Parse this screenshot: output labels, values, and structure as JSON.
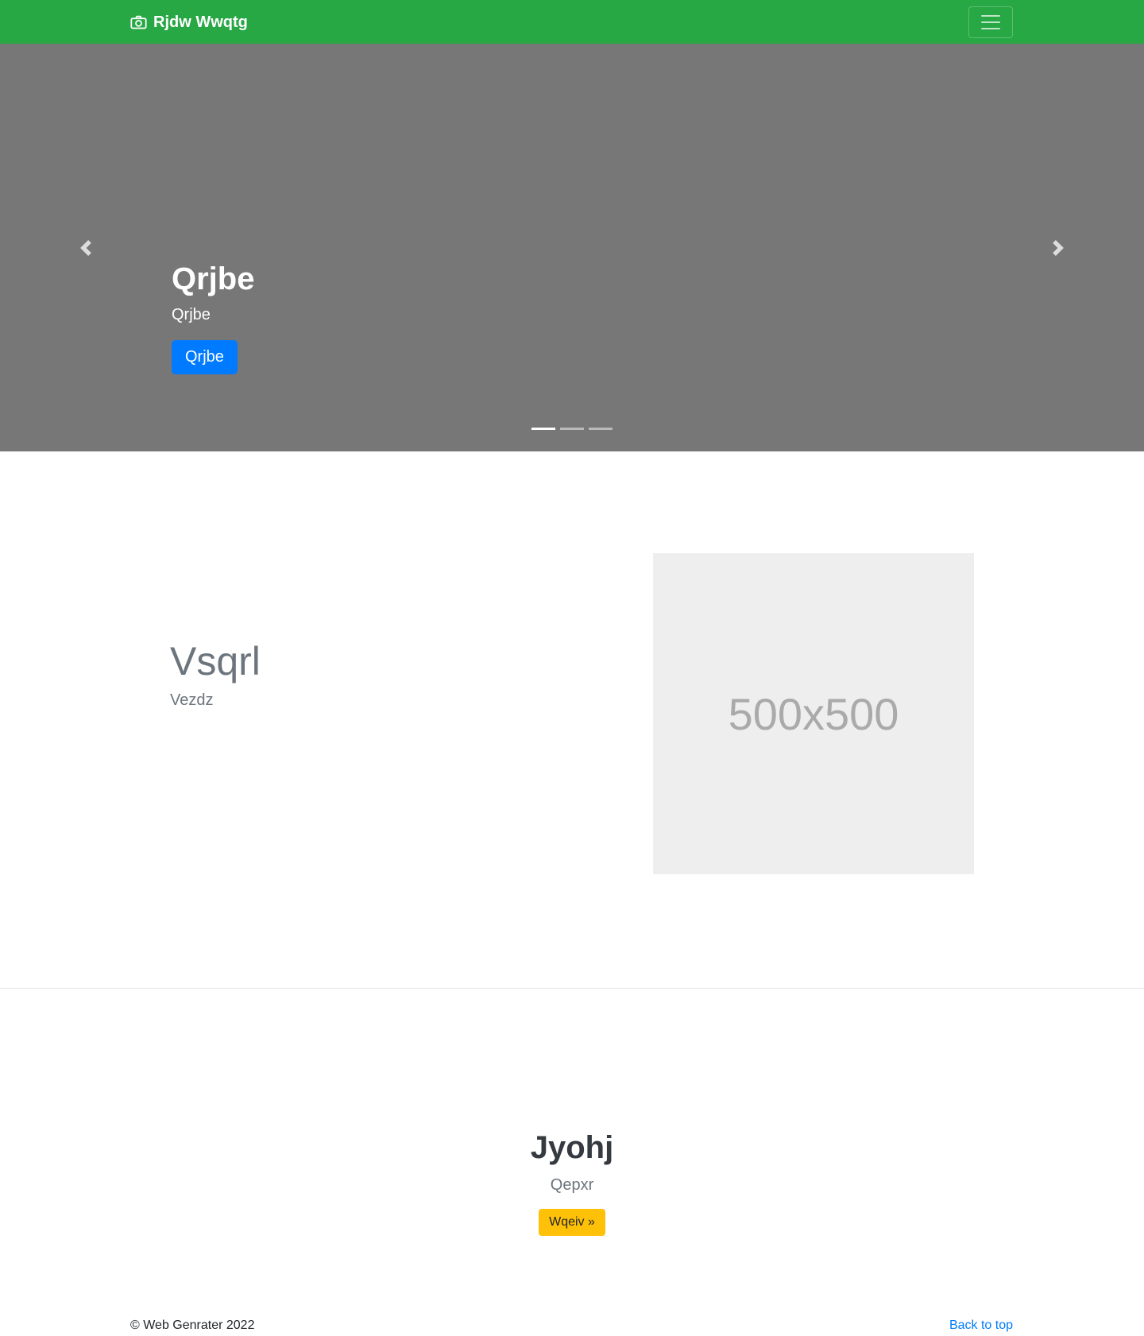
{
  "navbar": {
    "brand": "Rjdw Wwqtg",
    "brand_icon": "camera-icon",
    "toggler_icon": "hamburger-icon",
    "color": "#28a745"
  },
  "carousel": {
    "background": "#777777",
    "title": "Qrjbe",
    "subtitle": "Qrjbe",
    "button_label": "Qrjbe",
    "prev_icon": "chevron-left-icon",
    "next_icon": "chevron-right-icon",
    "slides_count": 3,
    "active_slide": 1
  },
  "featurette": {
    "heading": "Vsqrl",
    "lead": "Vezdz",
    "image_label": "500x500"
  },
  "cta": {
    "heading": "Jyohj",
    "text": "Qepxr",
    "button_label": "Wqeiv »"
  },
  "footer": {
    "copyright": "© Web Genrater 2022",
    "back_to_top": "Back to top"
  }
}
